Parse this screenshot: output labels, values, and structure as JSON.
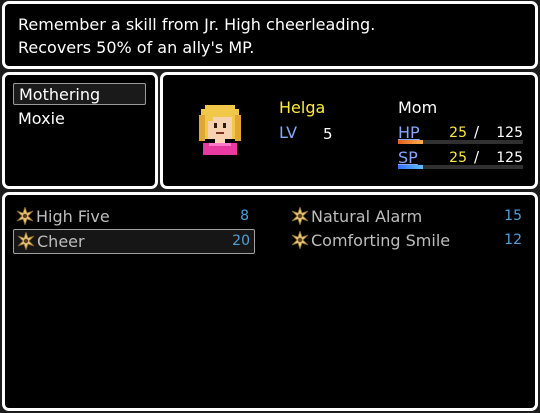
{
  "help": {
    "line1": "Remember a skill from Jr. High cheerleading.",
    "line2": "Recovers 50% of an ally's MP."
  },
  "categories": [
    {
      "label": "Mothering",
      "selected": true
    },
    {
      "label": "Moxie",
      "selected": false
    }
  ],
  "actor": {
    "name": "Helga",
    "class": "Mom",
    "level_label": "LV",
    "level": "5",
    "hp": {
      "label": "HP",
      "current": "25",
      "max": "125",
      "fraction": 0.2
    },
    "sp": {
      "label": "SP",
      "current": "25",
      "max": "125",
      "fraction": 0.2
    },
    "slash": "/"
  },
  "skills": [
    {
      "name": "High Five",
      "cost": "8",
      "icon": "starburst-icon",
      "selected": false
    },
    {
      "name": "Cheer",
      "cost": "20",
      "icon": "starburst-icon",
      "selected": true
    },
    {
      "name": "Natural Alarm",
      "cost": "15",
      "icon": "starburst-icon",
      "selected": false
    },
    {
      "name": "Comforting Smile",
      "cost": "12",
      "icon": "starburst-icon",
      "selected": false
    }
  ],
  "colors": {
    "name": "#ffeb3b",
    "system": "#84a8ff",
    "cost": "#4fa0d8",
    "hp_gauge": "#e06020",
    "sp_gauge": "#3070ff"
  }
}
